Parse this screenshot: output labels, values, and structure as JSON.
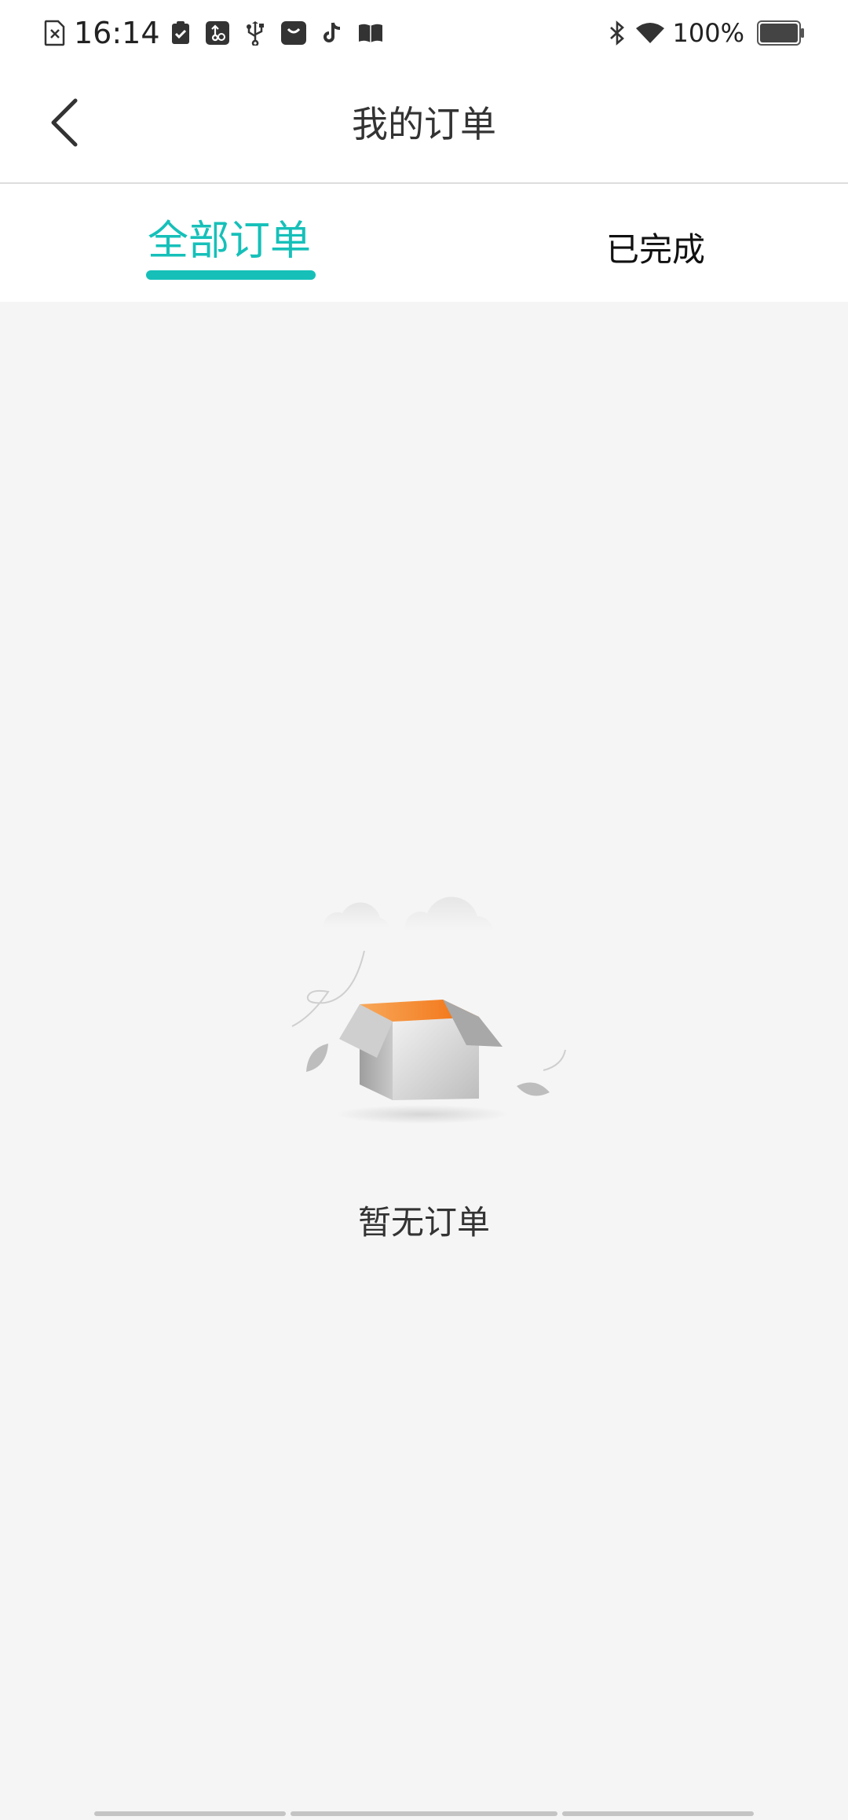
{
  "status_bar": {
    "time": "16:14",
    "battery_percent": "100%",
    "left_icons": [
      "sim-error-icon",
      "clipboard-check-icon",
      "usb-debug-icon",
      "usb-icon",
      "shopping-bag-icon",
      "tiktok-icon",
      "book-icon"
    ],
    "right_icons": [
      "bluetooth-icon",
      "wifi-icon",
      "battery-icon"
    ]
  },
  "nav": {
    "title": "我的订单",
    "back_icon": "chevron-left-icon"
  },
  "tabs": [
    {
      "label": "全部订单",
      "active": true
    },
    {
      "label": "已完成",
      "active": false
    }
  ],
  "empty_state": {
    "text": "暂无订单",
    "illustration": "open-box-icon"
  },
  "colors": {
    "accent": "#16c0b9",
    "background": "#f5f5f5",
    "box_lid": "#f58a1f"
  }
}
